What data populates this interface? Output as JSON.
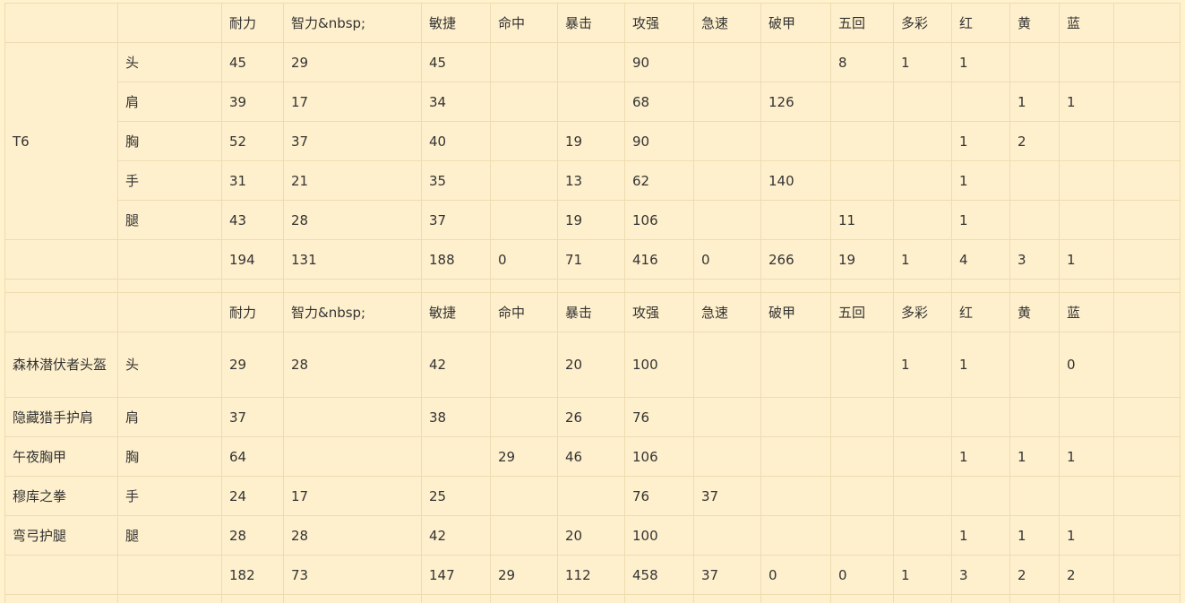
{
  "headers": [
    "耐力",
    "智力&nbsp;",
    "敏捷",
    "命中",
    "暴击",
    "攻强",
    "急速",
    "破甲",
    "五回",
    "多彩",
    "红",
    "黄",
    "蓝"
  ],
  "tables": [
    {
      "set_label": "T6",
      "rows": [
        {
          "slot": "头",
          "cells": [
            "45",
            "29",
            "45",
            "",
            "",
            "90",
            "",
            "",
            "8",
            "1",
            "1",
            "",
            ""
          ]
        },
        {
          "slot": "肩",
          "cells": [
            "39",
            "17",
            "34",
            "",
            "",
            "68",
            "",
            "126",
            "",
            "",
            "",
            "1",
            "1"
          ]
        },
        {
          "slot": "胸",
          "cells": [
            "52",
            "37",
            "40",
            "",
            "19",
            "90",
            "",
            "",
            "",
            "",
            "1",
            "2",
            ""
          ]
        },
        {
          "slot": "手",
          "cells": [
            "31",
            "21",
            "35",
            "",
            "13",
            "62",
            "",
            "140",
            "",
            "",
            "1",
            "",
            ""
          ]
        },
        {
          "slot": "腿",
          "cells": [
            "43",
            "28",
            "37",
            "",
            "19",
            "106",
            "",
            "",
            "11",
            "",
            "1",
            "",
            ""
          ]
        }
      ],
      "total": [
        "194",
        "131",
        "188",
        "0",
        "71",
        "416",
        "0",
        "266",
        "19",
        "1",
        "4",
        "3",
        "1"
      ]
    },
    {
      "rows": [
        {
          "item": "森林潜伏者头盔",
          "slot": "头",
          "cells": [
            "29",
            "28",
            "42",
            "",
            "20",
            "100",
            "",
            "",
            "",
            "1",
            "1",
            "",
            "0"
          ]
        },
        {
          "item": "隐藏猎手护肩",
          "slot": "肩",
          "cells": [
            "37",
            "",
            "38",
            "",
            "26",
            "76",
            "",
            "",
            "",
            "",
            "",
            "",
            ""
          ]
        },
        {
          "item": "午夜胸甲",
          "slot": "胸",
          "cells": [
            "64",
            "",
            "",
            "29",
            "46",
            "106",
            "",
            "",
            "",
            "",
            "1",
            "1",
            "1"
          ]
        },
        {
          "item": "穆库之拳",
          "slot": "手",
          "cells": [
            "24",
            "17",
            "25",
            "",
            "",
            "76",
            "37",
            "",
            "",
            "",
            "",
            "",
            ""
          ]
        },
        {
          "item": "弯弓护腿",
          "slot": "腿",
          "cells": [
            "28",
            "28",
            "42",
            "",
            "20",
            "100",
            "",
            "",
            "",
            "",
            "1",
            "1",
            "1"
          ]
        }
      ],
      "total": [
        "182",
        "73",
        "147",
        "29",
        "112",
        "458",
        "37",
        "0",
        "0",
        "1",
        "3",
        "2",
        "2"
      ]
    }
  ]
}
